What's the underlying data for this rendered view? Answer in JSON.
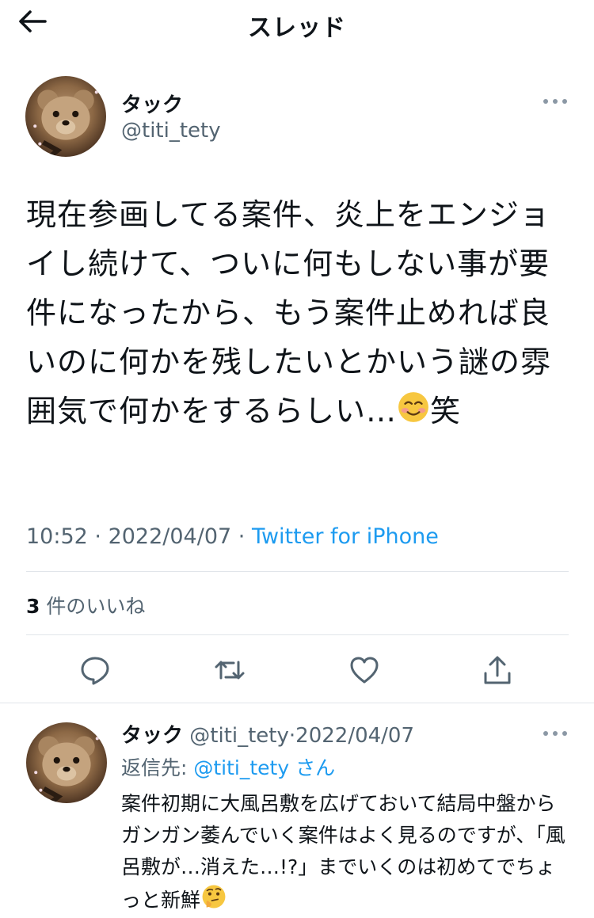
{
  "header": {
    "title": "スレッド"
  },
  "tweet": {
    "author_name": "タック",
    "author_handle": "@titi_tety",
    "text": "現在参画してる案件、炎上をエンジョイし続けて、ついに何もしない事が要件になったから、もう案件止めれば良いのに何かを残したいとかいう謎の雰囲気で何かをするらしい…",
    "text_tail": "笑",
    "emoji": "smiling-face-icon",
    "time": "10:52",
    "date": "2022/04/07",
    "source": "Twitter for iPhone",
    "like_count": "3",
    "like_label": "件のいいね"
  },
  "reply": {
    "author_name": "タック",
    "author_handle": "@titi_tety",
    "date": "2022/04/07",
    "reply_to_label": "返信先: ",
    "reply_to_handle": "@titi_tety",
    "reply_to_suffix": "さん",
    "text": "案件初期に大風呂敷を広げておいて結局中盤からガンガン萎んでいく案件はよく見るのですが、「風呂敷が…消えた…!?」までいくのは初めてでちょっと新鮮",
    "emoji": "thinking-face-icon"
  },
  "colors": {
    "link": "#1d9bf0",
    "secondary_text": "#536471",
    "primary_text": "#0f1419",
    "divider": "#e1e5ea"
  }
}
